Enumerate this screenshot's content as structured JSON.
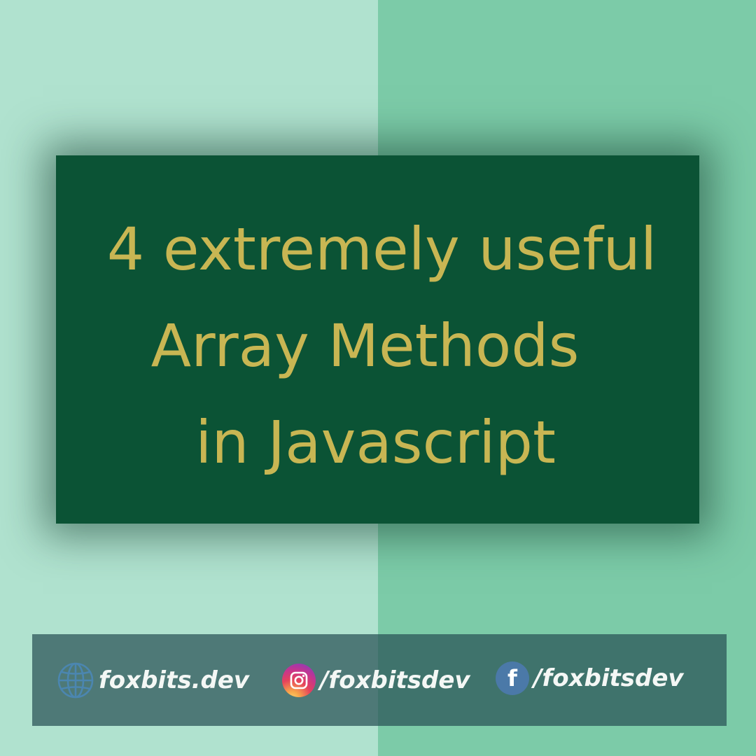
{
  "title": {
    "line1": "4 extremely useful",
    "line2": "Array Methods",
    "line3": "in Javascript"
  },
  "footer": {
    "website": {
      "icon": "globe-icon",
      "label": "foxbits.dev"
    },
    "instagram": {
      "icon": "instagram-icon",
      "label": "/foxbitsdev"
    },
    "facebook": {
      "icon": "facebook-icon",
      "glyph": "f",
      "label": "/foxbitsdev"
    }
  },
  "colors": {
    "background_left": "#b0e2cf",
    "background_right": "#7ccba8",
    "card": "#0b5335",
    "title_text": "#c8b653",
    "footer_bar": "#3e6e6e",
    "footer_text": "#f4f7f5",
    "globe": "#4b86b0",
    "facebook": "#4b79a8"
  }
}
